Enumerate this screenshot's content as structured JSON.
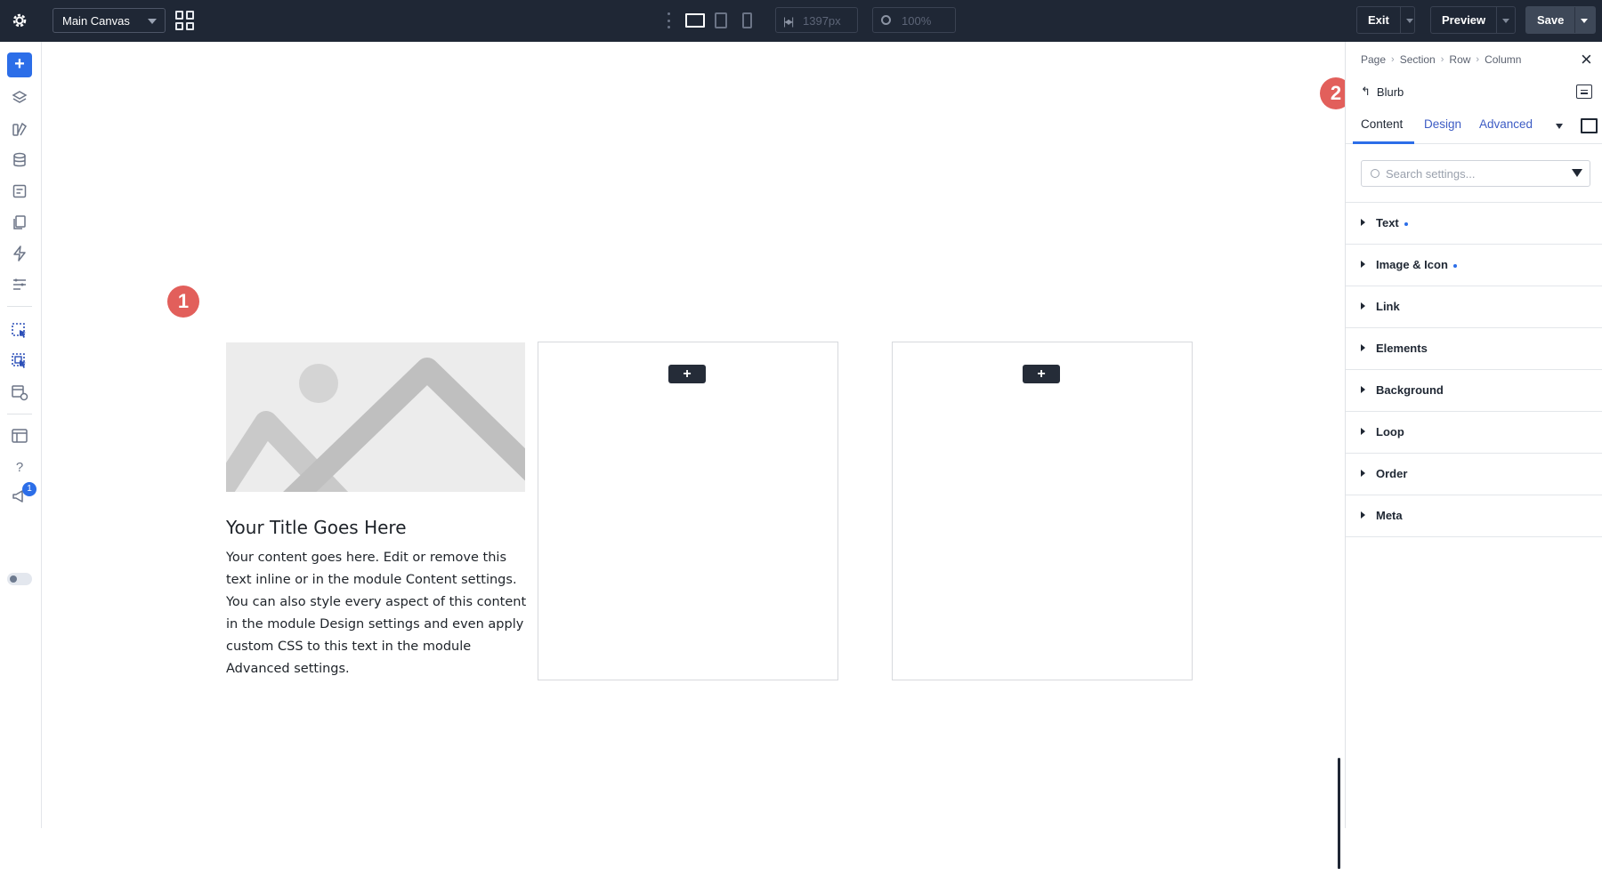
{
  "topbar": {
    "canvas_select": "Main Canvas",
    "width_value": "1397px",
    "zoom_value": "100%",
    "exit_label": "Exit",
    "preview_label": "Preview",
    "save_label": "Save"
  },
  "sidebar": {
    "notification_count": "1"
  },
  "canvas": {
    "markers": [
      "1",
      "2"
    ],
    "blurb": {
      "title": "Your Title Goes Here",
      "body": "Your content goes here. Edit or remove this text inline or in the module Content settings. You can also style every aspect of this content in the module Design settings and even apply custom CSS to this text in the module Advanced settings."
    },
    "add_button_label": "+"
  },
  "panel": {
    "breadcrumb": [
      "Page",
      "Section",
      "Row",
      "Column"
    ],
    "module_name": "Blurb",
    "tabs": [
      "Content",
      "Design",
      "Advanced"
    ],
    "active_tab": "Content",
    "search_placeholder": "Search settings...",
    "groups": [
      {
        "label": "Text",
        "modified": true
      },
      {
        "label": "Image & Icon",
        "modified": true
      },
      {
        "label": "Link",
        "modified": false
      },
      {
        "label": "Elements",
        "modified": false
      },
      {
        "label": "Background",
        "modified": false
      },
      {
        "label": "Loop",
        "modified": false
      },
      {
        "label": "Order",
        "modified": false
      },
      {
        "label": "Meta",
        "modified": false
      }
    ]
  },
  "colors": {
    "topbar_bg": "#1f2735",
    "accent": "#2c6ee8",
    "marker": "#e25f5b"
  }
}
